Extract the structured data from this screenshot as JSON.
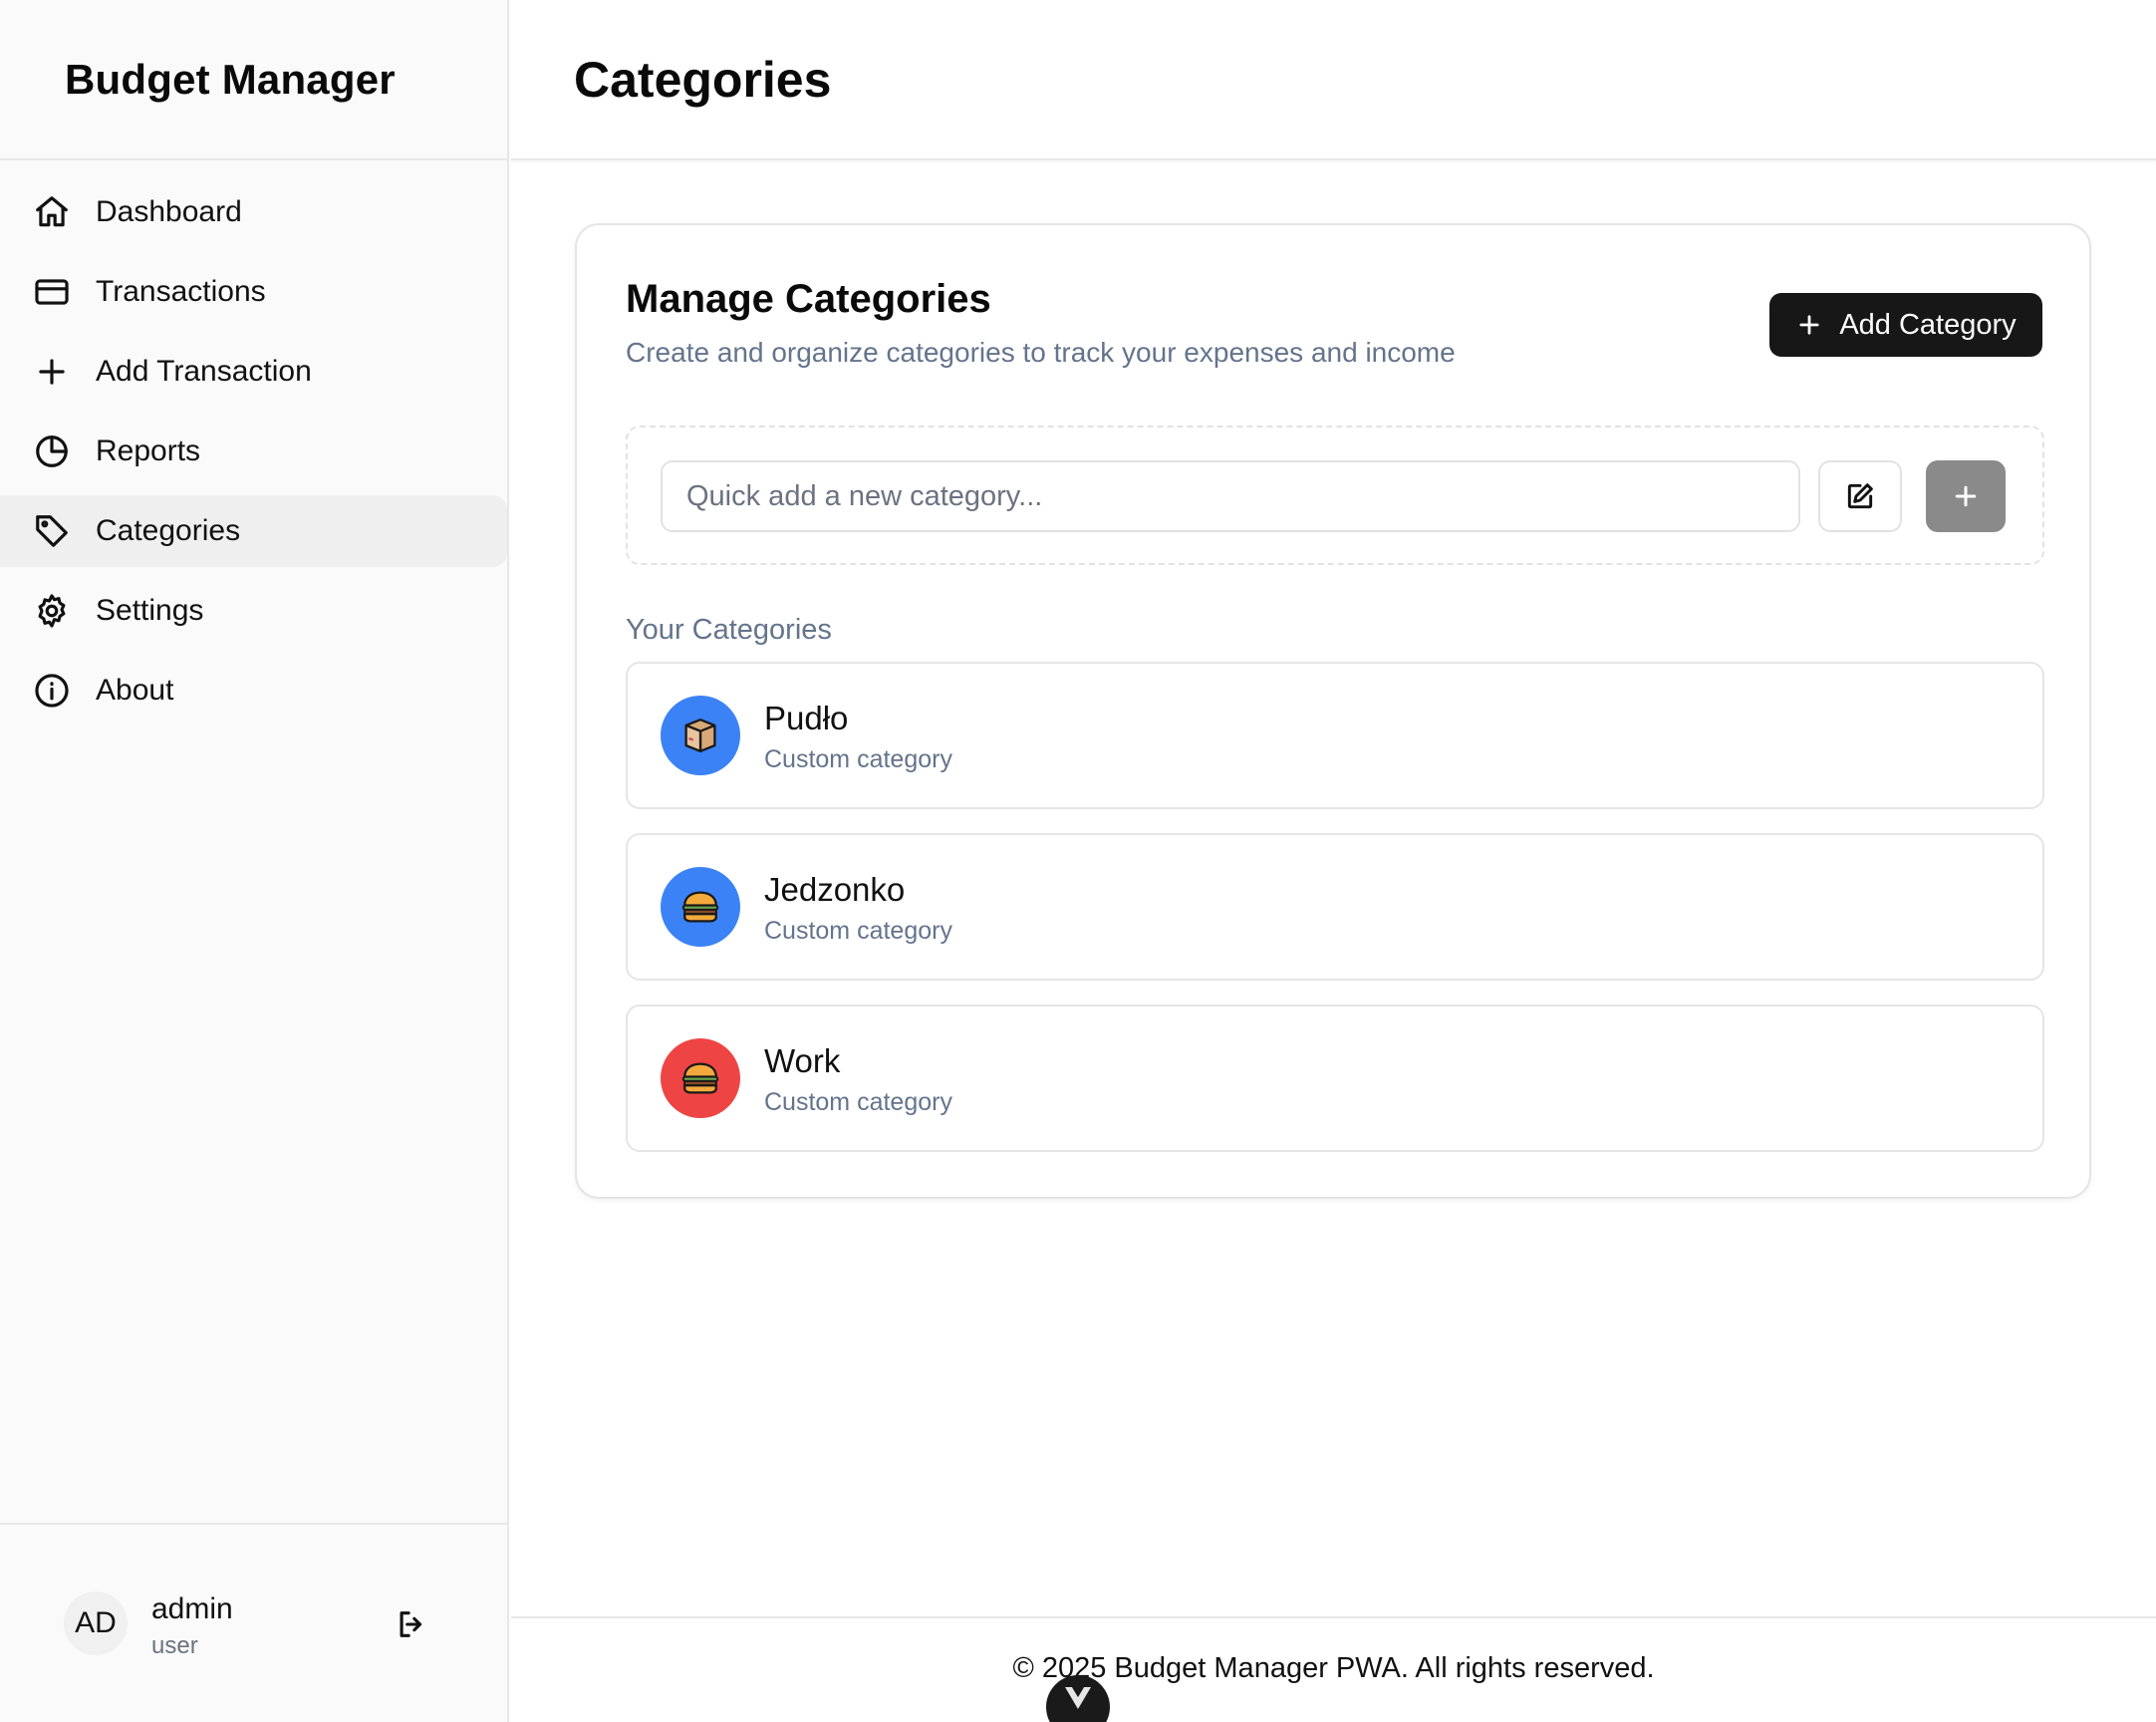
{
  "sidebar": {
    "brand": "Budget Manager",
    "items": [
      {
        "label": "Dashboard",
        "icon": "home-icon"
      },
      {
        "label": "Transactions",
        "icon": "credit-card-icon"
      },
      {
        "label": "Add Transaction",
        "icon": "plus-icon"
      },
      {
        "label": "Reports",
        "icon": "pie-chart-icon"
      },
      {
        "label": "Categories",
        "icon": "tag-icon",
        "active": true
      },
      {
        "label": "Settings",
        "icon": "gear-icon"
      },
      {
        "label": "About",
        "icon": "info-icon"
      }
    ],
    "user": {
      "initials": "AD",
      "name": "admin",
      "role": "user"
    }
  },
  "header": {
    "title": "Categories"
  },
  "card": {
    "title": "Manage Categories",
    "subtitle": "Create and organize categories to track your expenses and income",
    "add_button_label": "Add Category",
    "quick_add": {
      "placeholder": "Quick add a new category...",
      "value": ""
    },
    "section_label": "Your Categories",
    "categories": [
      {
        "name": "Pudło",
        "description": "Custom category",
        "emoji": "package-icon",
        "color": "#3b82f6"
      },
      {
        "name": "Jedzonko",
        "description": "Custom category",
        "emoji": "hamburger-icon",
        "color": "#3b82f6"
      },
      {
        "name": "Work",
        "description": "Custom category",
        "emoji": "hamburger-icon",
        "color": "#ef4444"
      }
    ]
  },
  "footer": {
    "text": "© 2025 Budget Manager PWA. All rights reserved."
  },
  "colors": {
    "primary_button": "#171717",
    "disabled_button": "#8a8a8a",
    "muted_text": "#64748b",
    "sidebar_bg": "#fafafa",
    "active_nav_bg": "#efefef"
  }
}
